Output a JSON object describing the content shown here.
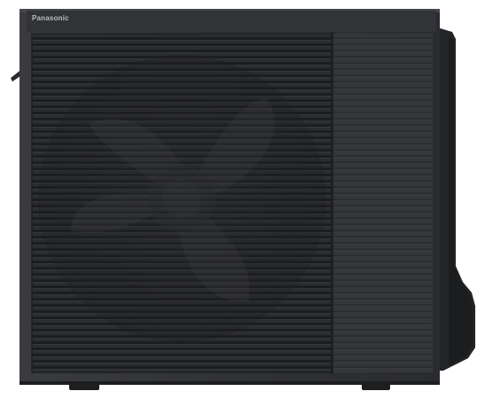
{
  "product": {
    "brand_logo_text": "Panasonic"
  },
  "colors": {
    "background": "#ffffff",
    "casing": "#2f3033",
    "grille": "#262729",
    "side_panel": "#343538",
    "trim": "#1a1b1d",
    "logo": "#b9bcc1"
  }
}
